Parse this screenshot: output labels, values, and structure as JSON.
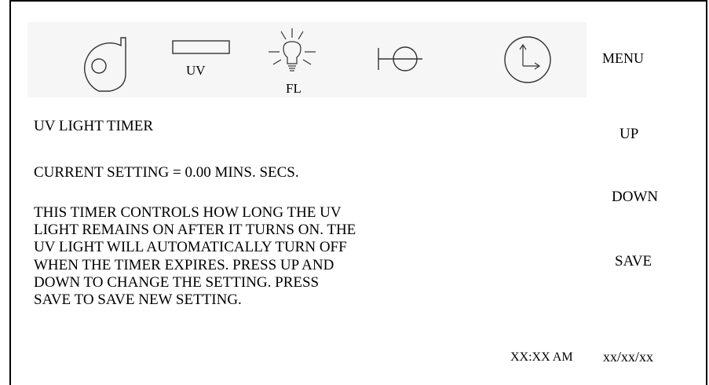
{
  "icons": {
    "fan": "fan-icon",
    "uv": "uv-lamp-icon",
    "fl": "fluorescent-light-icon",
    "valve": "valve-icon",
    "clock": "clock-icon"
  },
  "iconbar": {
    "uv_label": "UV",
    "fl_label": "FL",
    "menu": "MENU"
  },
  "screen": {
    "title": "UV LIGHT TIMER",
    "current_setting": "CURRENT SETTING = 0.00 MINS. SECS.",
    "description_lines": [
      "THIS TIMER CONTROLS HOW LONG THE UV",
      "LIGHT REMAINS ON AFTER IT TURNS ON.  THE",
      "UV LIGHT WILL AUTOMATICALLY TURN OFF",
      "WHEN THE TIMER EXPIRES.  PRESS UP AND",
      "DOWN TO CHANGE THE SETTING.  PRESS",
      "SAVE TO SAVE NEW SETTING."
    ]
  },
  "buttons": {
    "up": "UP",
    "down": "DOWN",
    "save": "SAVE"
  },
  "status": {
    "time": "XX:XX AM",
    "date": "xx/xx/xx"
  }
}
